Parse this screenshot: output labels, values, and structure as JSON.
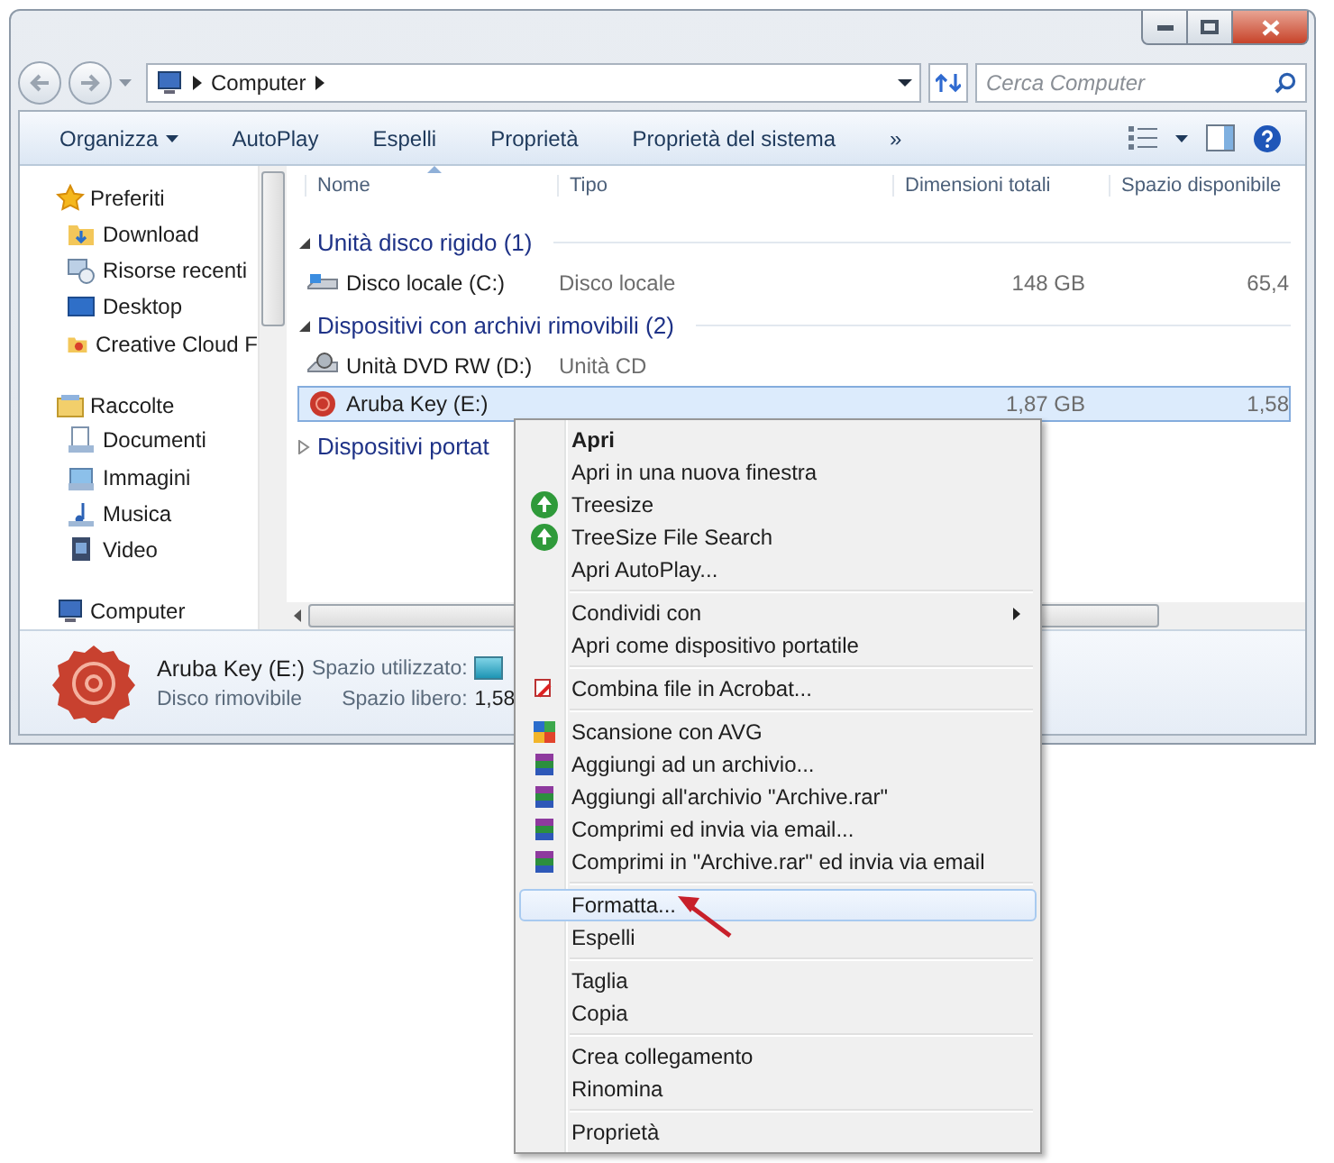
{
  "address": {
    "path": "Computer",
    "search_placeholder": "Cerca Computer"
  },
  "toolbar": [
    {
      "label": "Organizza",
      "dropdown": true
    },
    {
      "label": "AutoPlay",
      "dropdown": false
    },
    {
      "label": "Espelli",
      "dropdown": false
    },
    {
      "label": "Proprietà",
      "dropdown": false
    },
    {
      "label": "Proprietà del sistema",
      "dropdown": false
    },
    {
      "label": "»",
      "dropdown": false
    }
  ],
  "sidebar": [
    {
      "label": "Preferiti",
      "children": [
        {
          "label": "Download"
        },
        {
          "label": "Risorse recenti"
        },
        {
          "label": "Desktop"
        },
        {
          "label": "Creative Cloud F"
        }
      ]
    },
    {
      "label": "Raccolte",
      "children": [
        {
          "label": "Documenti"
        },
        {
          "label": "Immagini"
        },
        {
          "label": "Musica"
        },
        {
          "label": "Video"
        }
      ]
    },
    {
      "label": "Computer"
    }
  ],
  "columns": [
    "Nome",
    "Tipo",
    "Dimensioni totali",
    "Spazio disponibile"
  ],
  "groups": [
    {
      "title": "Unità disco rigido (1)",
      "expanded": true,
      "rows": [
        {
          "name": "Disco locale (C:)",
          "type": "Disco locale",
          "size": "148 GB",
          "free": "65,4",
          "selected": false
        }
      ]
    },
    {
      "title": "Dispositivi con archivi rimovibili (2)",
      "expanded": true,
      "rows": [
        {
          "name": "Unità DVD RW (D:)",
          "type": "Unità CD",
          "selected": false
        },
        {
          "name": "Aruba Key (E:)",
          "size": "1,87 GB",
          "free": "1,58",
          "selected": true
        }
      ]
    },
    {
      "title": "Dispositivi portat",
      "expanded": false
    }
  ],
  "details": {
    "name": "Aruba Key (E:)",
    "type": "Disco rimovibile",
    "used_label": "Spazio utilizzato:",
    "free_label": "Spazio libero:",
    "free_value": "1,58"
  },
  "menu": {
    "sections": [
      {
        "items": [
          {
            "label": "Apri",
            "default": true,
            "submenu": false,
            "selected": false
          },
          {
            "label": "Apri in una nuova finestra",
            "default": false,
            "submenu": false,
            "selected": false
          },
          {
            "label": "Treesize",
            "default": false,
            "submenu": false,
            "selected": false
          },
          {
            "label": "TreeSize File Search",
            "default": false,
            "submenu": false,
            "selected": false
          },
          {
            "label": "Apri AutoPlay...",
            "default": false,
            "submenu": false,
            "selected": false
          }
        ]
      },
      {
        "items": [
          {
            "label": "Condividi con",
            "default": false,
            "submenu": true,
            "selected": false
          },
          {
            "label": "Apri come dispositivo portatile",
            "default": false,
            "submenu": false,
            "selected": false
          }
        ]
      },
      {
        "items": [
          {
            "label": "Combina file in Acrobat...",
            "default": false,
            "submenu": false,
            "selected": false
          }
        ]
      },
      {
        "items": [
          {
            "label": "Scansione con AVG",
            "default": false,
            "submenu": false,
            "selected": false
          },
          {
            "label": "Aggiungi ad un archivio...",
            "default": false,
            "submenu": false,
            "selected": false
          },
          {
            "label": "Aggiungi all'archivio \"Archive.rar\"",
            "default": false,
            "submenu": false,
            "selected": false
          },
          {
            "label": "Comprimi ed invia via email...",
            "default": false,
            "submenu": false,
            "selected": false
          },
          {
            "label": "Comprimi in \"Archive.rar\" ed invia via email",
            "default": false,
            "submenu": false,
            "selected": false
          }
        ]
      },
      {
        "items": [
          {
            "label": "Formatta...",
            "default": false,
            "submenu": false,
            "selected": true
          },
          {
            "label": "Espelli",
            "default": false,
            "submenu": false,
            "selected": false
          }
        ]
      },
      {
        "items": [
          {
            "label": "Taglia",
            "default": false,
            "submenu": false,
            "selected": false
          },
          {
            "label": "Copia",
            "default": false,
            "submenu": false,
            "selected": false
          }
        ]
      },
      {
        "items": [
          {
            "label": "Crea collegamento",
            "default": false,
            "submenu": false,
            "selected": false
          },
          {
            "label": "Rinomina",
            "default": false,
            "submenu": false,
            "selected": false
          }
        ]
      },
      {
        "items": [
          {
            "label": "Proprietà",
            "default": false,
            "submenu": false,
            "selected": false
          }
        ]
      }
    ]
  }
}
